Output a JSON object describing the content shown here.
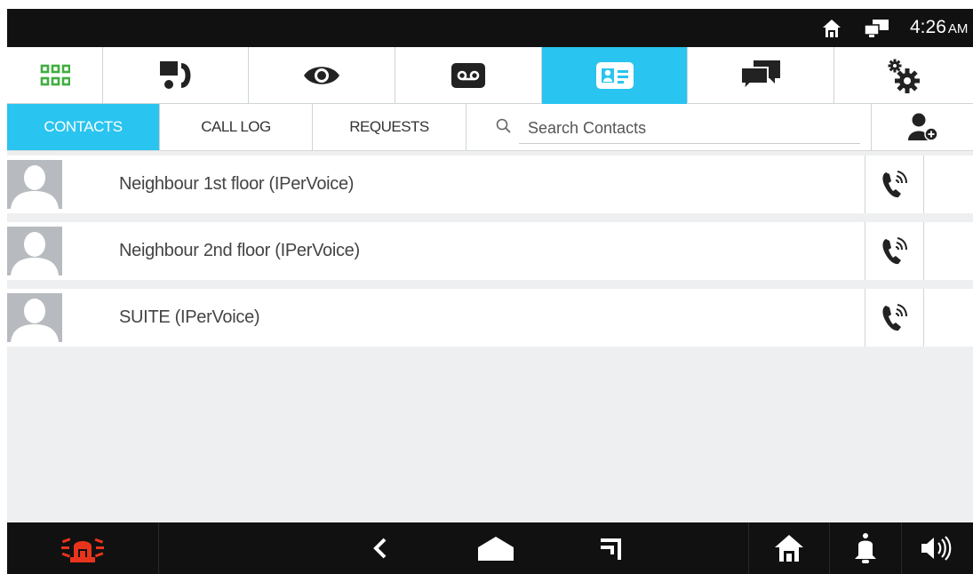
{
  "status_bar": {
    "time": "4:26",
    "ampm": "AM",
    "icons": [
      "home-icon",
      "network-icon"
    ]
  },
  "main_tabs": [
    {
      "name": "apps-grid-icon",
      "active": false
    },
    {
      "name": "intercom-call-icon",
      "active": false
    },
    {
      "name": "eye-icon",
      "active": false
    },
    {
      "name": "voicemail-icon",
      "active": false
    },
    {
      "name": "contact-card-icon",
      "active": true
    },
    {
      "name": "chat-icon",
      "active": false
    },
    {
      "name": "settings-gears-icon",
      "active": false
    }
  ],
  "sub_tabs": {
    "contacts": "CONTACTS",
    "call_log": "CALL LOG",
    "requests": "REQUESTS",
    "active": "contacts"
  },
  "search": {
    "placeholder": "Search Contacts",
    "value": ""
  },
  "contacts": [
    {
      "name": "Neighbour 1st floor (IPerVoice)"
    },
    {
      "name": "Neighbour 2nd floor (IPerVoice)"
    },
    {
      "name": "SUITE (IPerVoice)"
    }
  ],
  "nav_bar": {
    "icons": [
      "alarm-siren-icon",
      "back-icon",
      "home-shape-icon",
      "recents-icon",
      "house-icon",
      "bell-icon",
      "volume-icon"
    ]
  },
  "colors": {
    "accent": "#29c4ef",
    "grid_green": "#3fae3f",
    "alarm_red": "#e8341c",
    "status_bar": "#111111",
    "list_bg": "#eeeff1",
    "avatar": "#b7bbc0"
  }
}
